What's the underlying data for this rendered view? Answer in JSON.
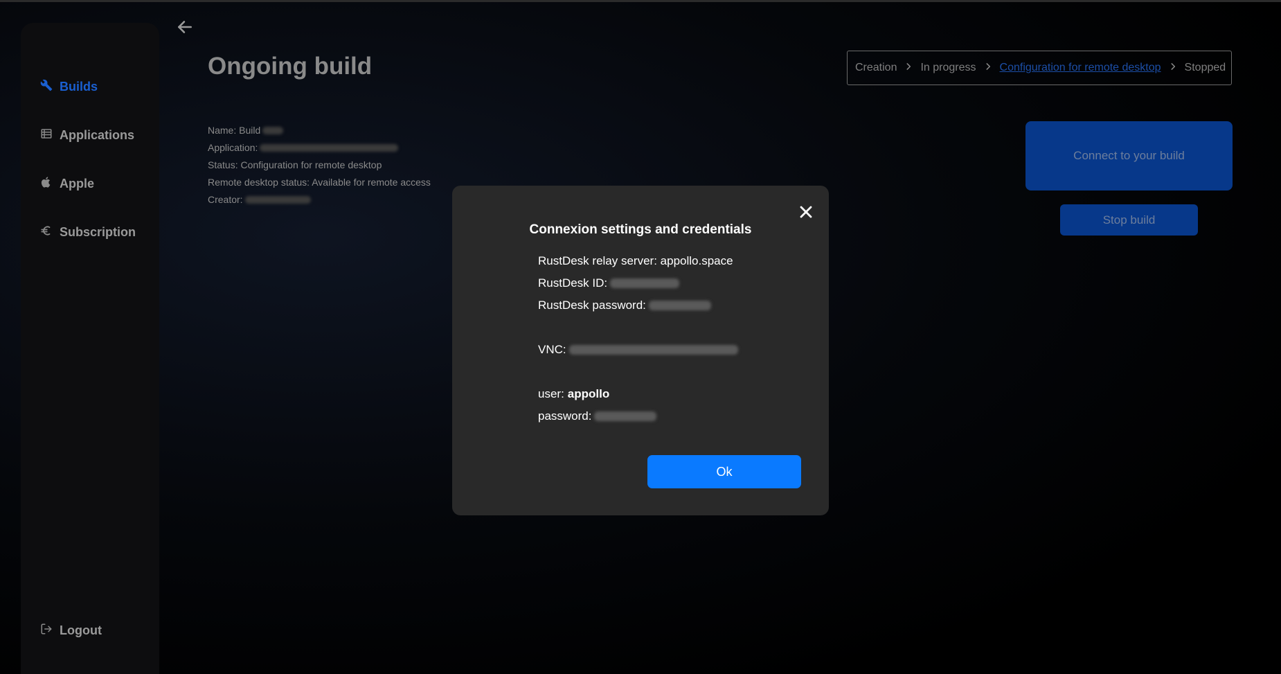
{
  "sidebar": {
    "items": [
      {
        "label": "Builds",
        "icon": "wrench-icon",
        "active": true
      },
      {
        "label": "Applications",
        "icon": "list-icon",
        "active": false
      },
      {
        "label": "Apple",
        "icon": "apple-icon",
        "active": false
      },
      {
        "label": "Subscription",
        "icon": "euro-icon",
        "active": false
      }
    ],
    "logout_label": "Logout"
  },
  "main": {
    "title": "Ongoing build",
    "info": {
      "name_label": "Name: Build",
      "application_label": "Application:",
      "status_label": "Status: Configuration for remote desktop",
      "remote_status_label": "Remote desktop status: Available for remote access",
      "creator_label": "Creator:"
    },
    "breadcrumb": {
      "steps": [
        "Creation",
        "In progress",
        "Configuration for remote desktop",
        "Stopped"
      ],
      "current_index": 2
    },
    "connect_button": "Connect to your build",
    "stop_button": "Stop build"
  },
  "modal": {
    "title": "Connexion settings and credentials",
    "relay_server_label": "RustDesk relay server: appollo.space",
    "rustdesk_id_label": "RustDesk ID:",
    "rustdesk_password_label": "RustDesk password:",
    "vnc_label": "VNC:",
    "user_label": "user:",
    "user_value": "appollo",
    "password_label": "password:",
    "ok_button": "Ok"
  },
  "colors": {
    "accent": "#0a7aff",
    "active_nav": "#1a5fd0",
    "dim_button": "#07388a",
    "modal_bg": "#292929"
  }
}
